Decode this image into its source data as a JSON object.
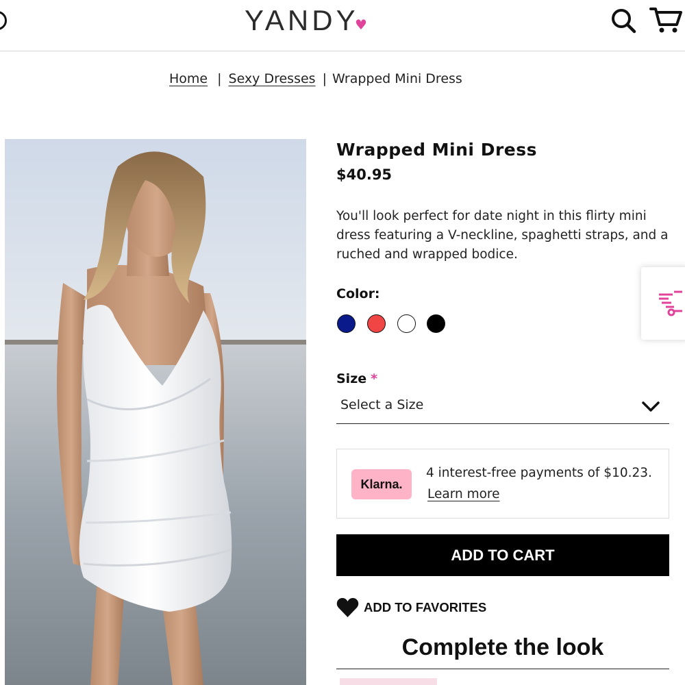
{
  "header": {
    "logo_text": "YANDY",
    "logo_heart": "♥",
    "brand_color": "#e0439a",
    "icons": [
      "search-icon",
      "cart-icon"
    ]
  },
  "breadcrumb": {
    "home": "Home",
    "category": "Sexy Dresses",
    "current": "Wrapped Mini Dress",
    "separator": "|"
  },
  "product": {
    "title": "Wrapped Mini Dress",
    "price": "$40.95",
    "description": "You'll look perfect for date night in this flirty mini dress featuring a V-neckline, spaghetti straps, and a ruched and wrapped bodice.",
    "color_label": "Color:",
    "colors": [
      {
        "name": "navy",
        "hex": "#0b1a8a"
      },
      {
        "name": "red",
        "hex": "#f04545"
      },
      {
        "name": "white",
        "hex": "#ffffff"
      },
      {
        "name": "black",
        "hex": "#000000"
      }
    ],
    "size_label": "Size",
    "size_required": "*",
    "size_placeholder": "Select a Size"
  },
  "klarna": {
    "badge": "Klarna.",
    "text": "4 interest-free payments of $10.23.",
    "link": "Learn more",
    "badge_color": "#ffb3c7"
  },
  "actions": {
    "add_to_cart": "ADD TO CART",
    "add_to_favorites": "ADD TO FAVORITES"
  },
  "complete_the_look": "Complete the look"
}
